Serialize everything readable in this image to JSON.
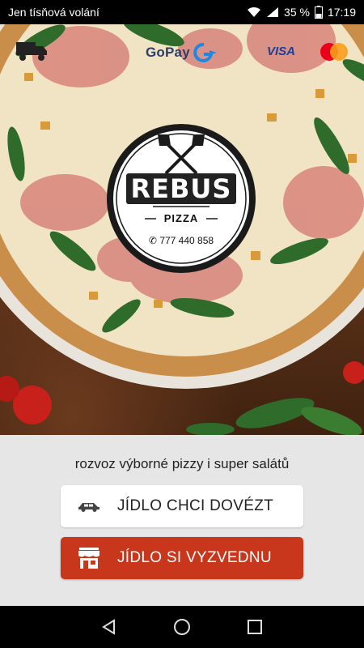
{
  "status_bar": {
    "carrier": "Jen tísňová volání",
    "battery": "35 %",
    "time": "17:19"
  },
  "hero": {
    "payment_logos": {
      "gopay": "GoPay",
      "visa": "VISA",
      "mastercard": "mastercard"
    },
    "brand": {
      "name": "REBUS",
      "subtitle": "PIZZA",
      "phone": "777 440 858"
    }
  },
  "main": {
    "tagline": "rozvoz výborné pizzy i super salátů",
    "delivery_button": {
      "label": "JÍDLO CHCI DOVÉZT",
      "icon": "car-icon"
    },
    "pickup_button": {
      "label": "JÍDLO SI VYZVEDNU",
      "icon": "shop-icon"
    }
  },
  "colors": {
    "pickup_button": "#c8361b",
    "panel": "#e6e6e6",
    "accent_blue": "#1a3e9a"
  },
  "nav_bar": {
    "back_icon": "triangle-back-icon",
    "home_icon": "circle-home-icon",
    "recents_icon": "square-recents-icon"
  }
}
